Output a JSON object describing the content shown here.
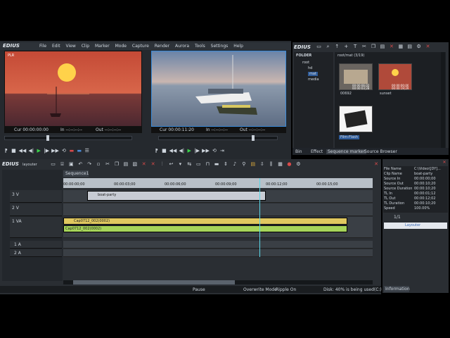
{
  "app": {
    "logo": "EDIUS",
    "menu": [
      "File",
      "Edit",
      "View",
      "Clip",
      "Marker",
      "Mode",
      "Capture",
      "Render",
      "Aurora",
      "Tools",
      "Settings",
      "Help"
    ]
  },
  "player": {
    "label": "PLR",
    "timecodes": {
      "cur": "Cur 00:00:00:00",
      "in": "In --:--:--:--",
      "out": "Out --:--:--:--"
    }
  },
  "recorder": {
    "timecodes": {
      "cur": "Cur 00:00:11:20",
      "in": "In --:--:--:--",
      "out": "Out --:--:--:--"
    }
  },
  "bin": {
    "logo": "EDIUS",
    "folder_title": "FOLDER",
    "path_title": "root/mat (3/19)",
    "tree": [
      "root",
      "hd",
      "mat",
      "media"
    ],
    "clips": [
      {
        "name": "00692",
        "tc1": "00:00:06;02",
        "tc2": "00:00:03;28"
      },
      {
        "name": "sunset",
        "tc1": "00:00:00;00",
        "tc2": "00:00:19;29"
      },
      {
        "name": "Film-Flash",
        "tc1": "",
        "tc2": ""
      }
    ],
    "tabs": [
      "Bin",
      "Effect",
      "Sequence marker",
      "Source Browser"
    ]
  },
  "timeline": {
    "logo": "EDIUS",
    "project": "layouter",
    "sequence_tab": "Sequence1",
    "ruler": [
      "00:00:00;00",
      "00:00:03;00",
      "00:00:06;00",
      "00:00:09;00",
      "00:00:12;00",
      "00:00:15;00"
    ],
    "tracks": [
      "3 V",
      "2 V",
      "1 VA",
      "1 A",
      "2 A"
    ],
    "clips": {
      "title_clip": "boat-party",
      "video_clip": "Cap0712_002(0002)",
      "audio_clip": "Cap0712_002(0002)"
    }
  },
  "info_panel": {
    "rows": [
      {
        "k": "File Name",
        "v": "C:\\Video\\[DY]..."
      },
      {
        "k": "Clip Name",
        "v": "boat-party"
      },
      {
        "k": "Source In",
        "v": "00:00:00;00"
      },
      {
        "k": "Source Out",
        "v": "00:00:10;20"
      },
      {
        "k": "Source Duration",
        "v": "00:00:10;20"
      },
      {
        "k": "TL In",
        "v": "00:00:01;12"
      },
      {
        "k": "TL Out",
        "v": "00:00:12;02"
      },
      {
        "k": "TL Duration",
        "v": "00:00:10;20"
      },
      {
        "k": "Speed",
        "v": "100.00%"
      }
    ],
    "counter": "1/1",
    "layer_item": "Layouter",
    "tab": "Information"
  },
  "status": {
    "pause": "Pause",
    "mode": "Overwrite Mode",
    "ripple": "Ripple On",
    "disk": "Disk: 40% is being used(C:)"
  }
}
